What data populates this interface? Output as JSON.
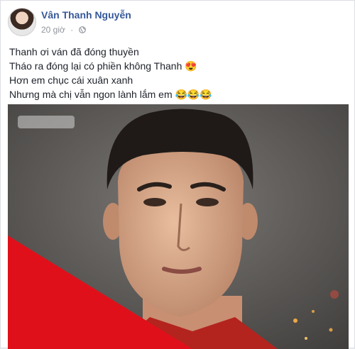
{
  "post": {
    "author": "Vân Thanh Nguyễn",
    "time": "20 giờ",
    "dot": "·",
    "lines": [
      "Thanh ơi ván đã đóng thuyền",
      "Tháo ra đóng lại có phiền không Thanh",
      "Hơn em chục cái xuân xanh",
      "Nhưng mà chị vẫn ngon lành lắm em"
    ],
    "emoji_heart_eyes": "😍",
    "emoji_laughing": "😂😂😂"
  },
  "colors": {
    "author_link": "#365899",
    "meta": "#90949c",
    "red_banner": "#e0101a"
  },
  "photo": {
    "subject": "portrait-photo"
  }
}
